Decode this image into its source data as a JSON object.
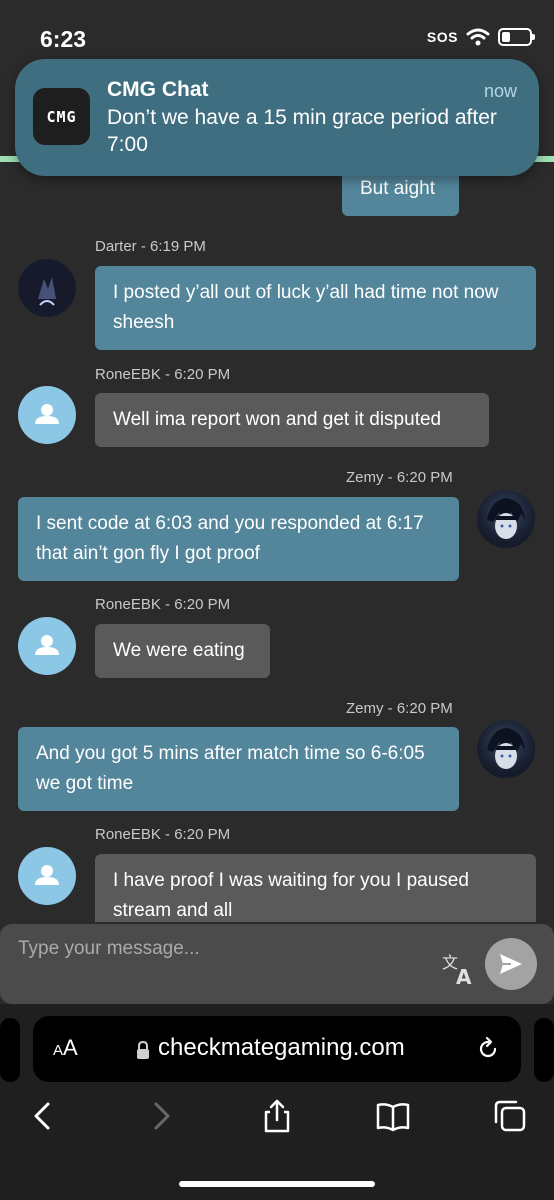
{
  "status_bar": {
    "time": "6:23",
    "sos": "SOS",
    "battery_level": 0.3
  },
  "notification": {
    "app": "CMG Chat",
    "icon_text": "CMG",
    "time": "now",
    "body": "Don’t we have a 15 min grace period after 7:00"
  },
  "messages": [
    {
      "author": "",
      "timestamp": "",
      "text": "But aight",
      "side": "right",
      "style": "blue"
    },
    {
      "author": "Darter",
      "timestamp": "6:19 PM",
      "text": "I posted y’all out of luck y’all had time not now sheesh",
      "side": "left",
      "style": "blue",
      "avatar": "dark-avatar"
    },
    {
      "author": "RoneEBK",
      "timestamp": "6:20 PM",
      "text": "Well ima report won and get it disputed",
      "side": "left",
      "style": "gray",
      "avatar": "default-user-avatar"
    },
    {
      "author": "Zemy",
      "timestamp": "6:20 PM",
      "text": "I sent code at 6:03 and you responded at 6:17 that ain’t gon fly I got proof",
      "side": "right",
      "style": "blue",
      "avatar": "anime-avatar"
    },
    {
      "author": "RoneEBK",
      "timestamp": "6:20 PM",
      "text": "We were eating",
      "side": "left",
      "style": "gray",
      "avatar": "default-user-avatar"
    },
    {
      "author": "Zemy",
      "timestamp": "6:20 PM",
      "text": "And you got 5 mins after match time so 6-6:05 we got time",
      "side": "right",
      "style": "blue",
      "avatar": "anime-avatar"
    },
    {
      "author": "RoneEBK",
      "timestamp": "6:20 PM",
      "text": "I have proof I was waiting for you I paused stream and all",
      "side": "left",
      "style": "gray",
      "avatar": "default-user-avatar"
    }
  ],
  "composer": {
    "placeholder": "Type your message..."
  },
  "browser": {
    "aa_label_small": "A",
    "aa_label_large": "A",
    "url": "checkmategaming.com"
  },
  "colors": {
    "bubble_blue": "#53869b",
    "bubble_gray": "#5a5a5a",
    "background": "#2b2b2b",
    "notification": "#3f6e80"
  }
}
